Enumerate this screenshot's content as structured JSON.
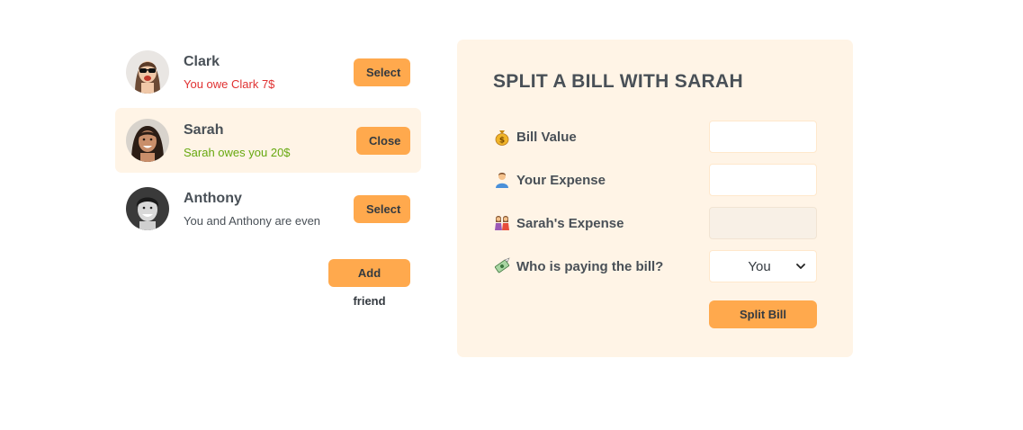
{
  "friends": [
    {
      "name": "Clark",
      "balance": "You owe Clark 7$",
      "balance_tone": "red",
      "button": "Select",
      "selected": false
    },
    {
      "name": "Sarah",
      "balance": "Sarah owes you 20$",
      "balance_tone": "green",
      "button": "Close",
      "selected": true
    },
    {
      "name": "Anthony",
      "balance": "You and Anthony are even",
      "balance_tone": "neutral",
      "button": "Select",
      "selected": false
    }
  ],
  "add_friend_label": "Add friend",
  "form": {
    "title": "SPLIT A BILL WITH SARAH",
    "bill_value": {
      "label": "Bill Value",
      "icon": "money-bag-icon",
      "value": ""
    },
    "your_expense": {
      "label": "Your Expense",
      "icon": "person-icon",
      "value": ""
    },
    "friend_expense": {
      "label": "Sarah's Expense",
      "icon": "two-women-icon",
      "value": ""
    },
    "payer": {
      "label": "Who is paying the bill?",
      "icon": "money-with-wings-icon",
      "selected": "You"
    },
    "submit_label": "Split Bill"
  },
  "colors": {
    "accent": "#ffa94d",
    "panel_bg": "#fff4e6",
    "owe_red": "#e03131",
    "owed_green": "#66a80f",
    "text": "#495057"
  }
}
